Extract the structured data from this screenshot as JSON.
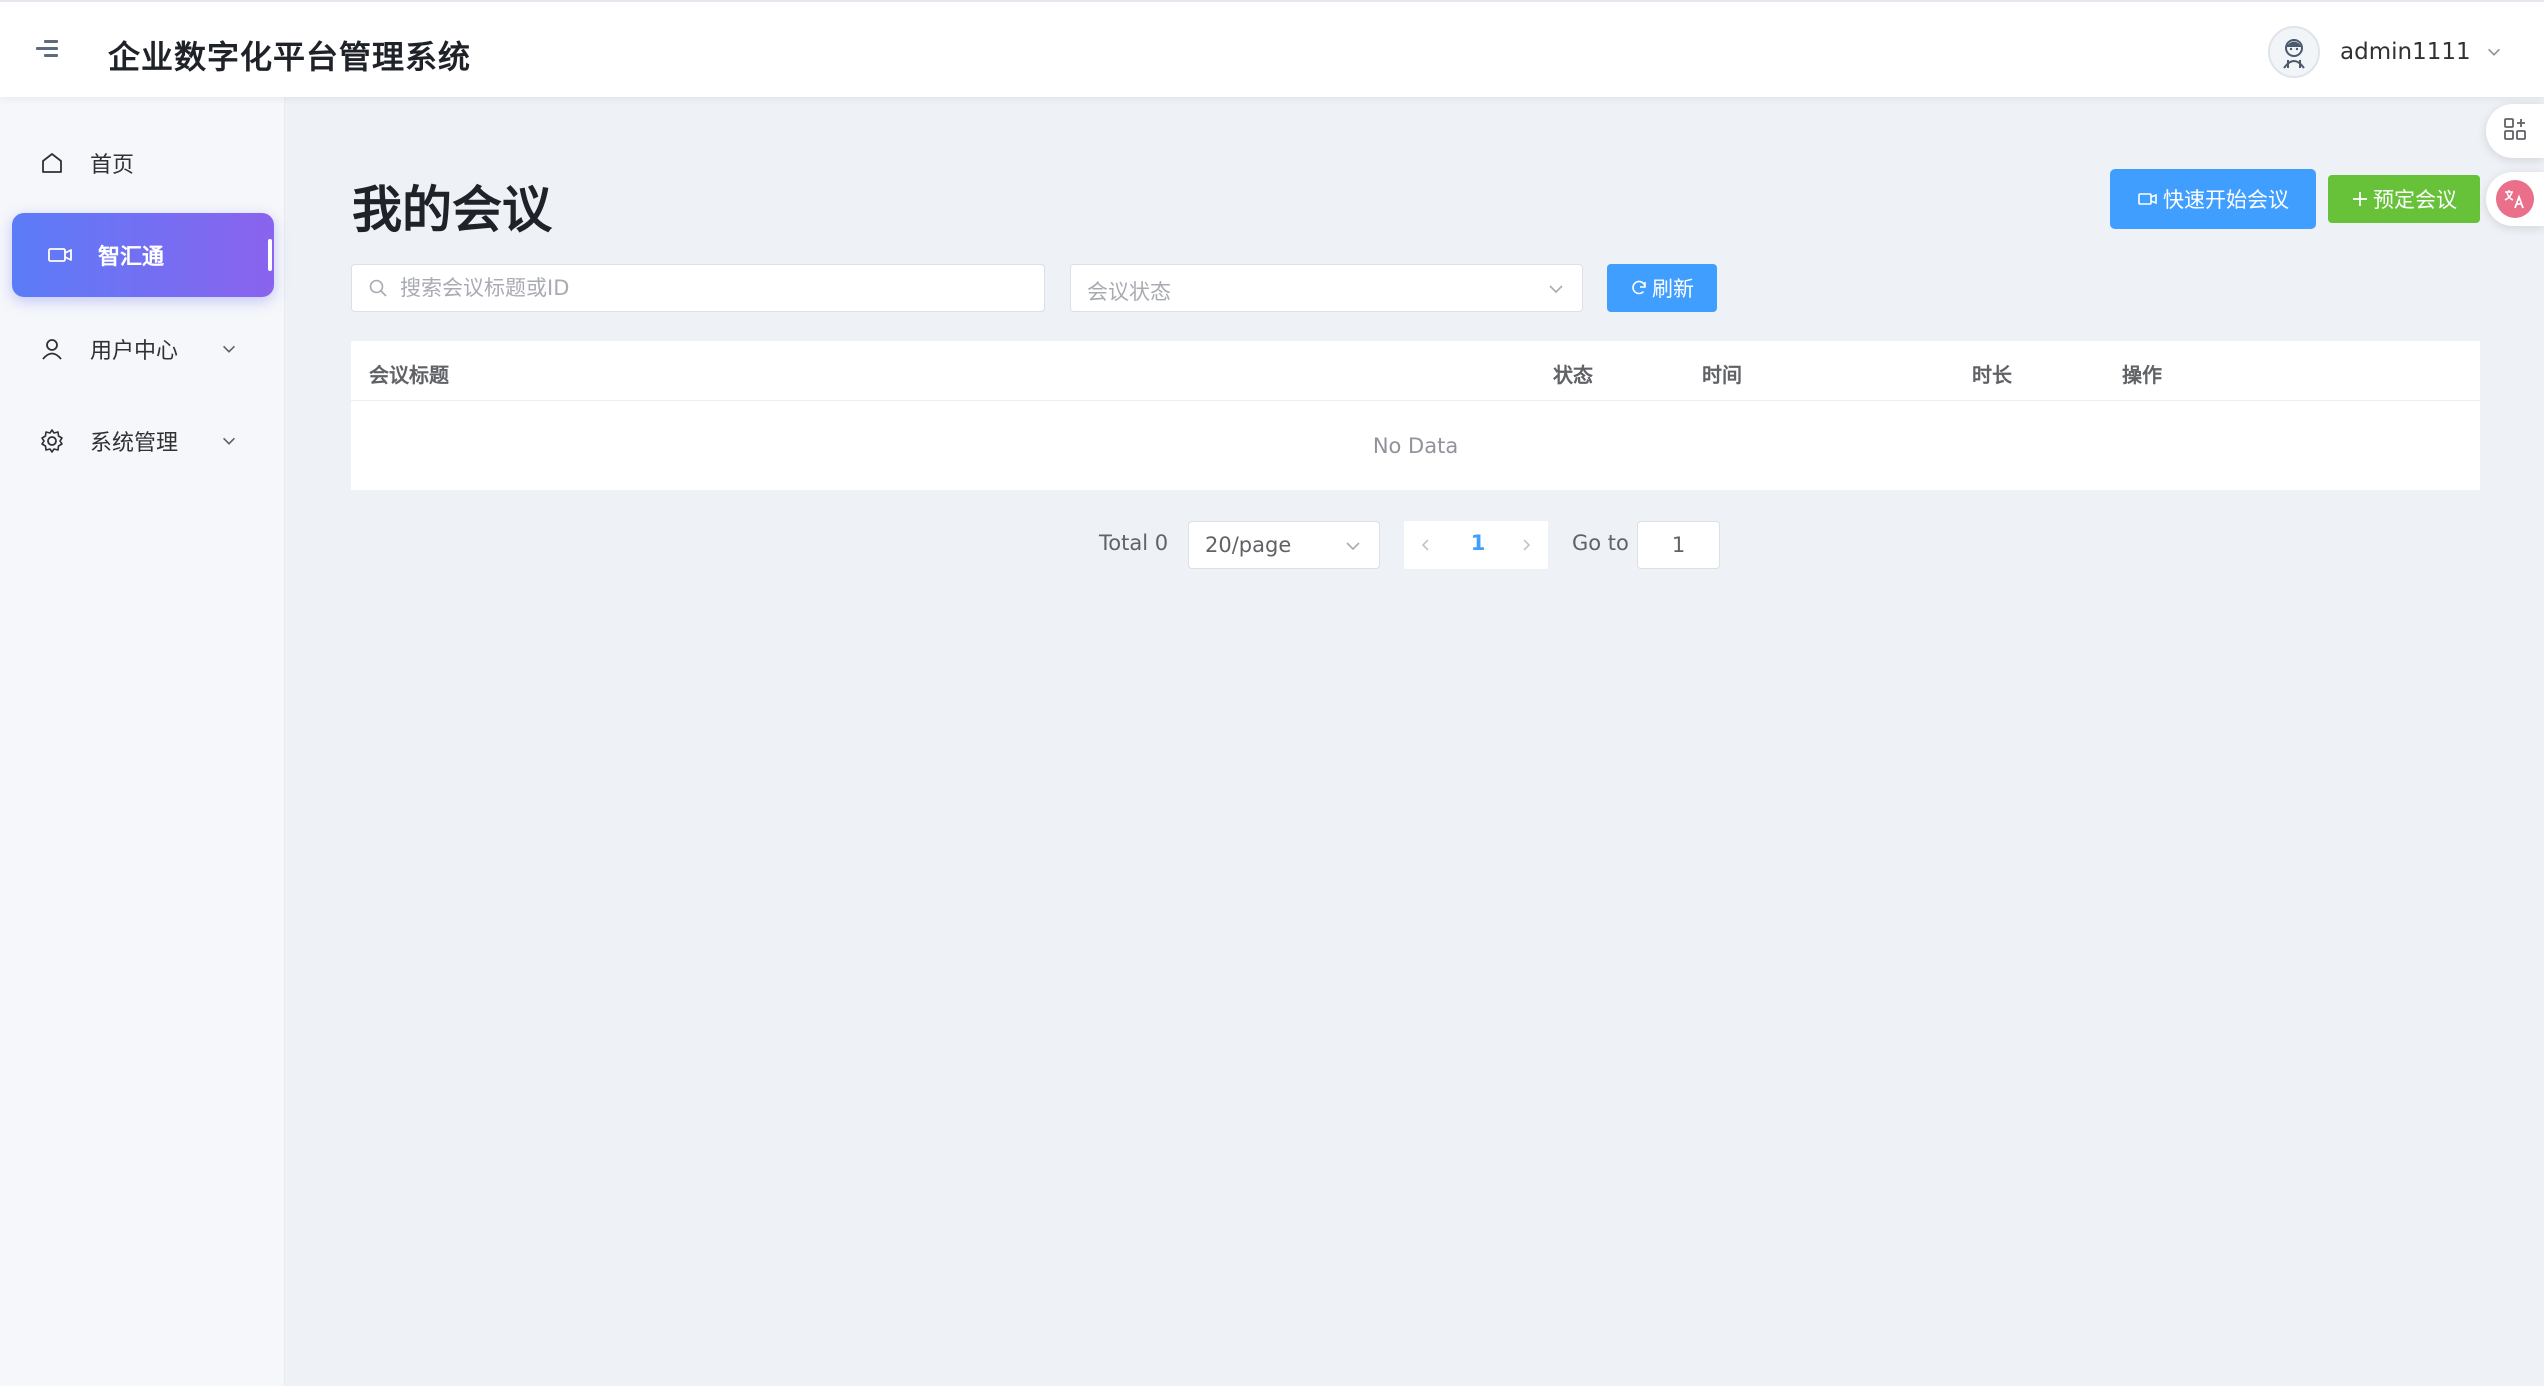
{
  "header": {
    "app_title": "企业数字化平台管理系统",
    "username": "admin1111"
  },
  "sidebar": {
    "items": [
      {
        "label": "首页",
        "icon": "home-icon",
        "active": false,
        "expandable": false
      },
      {
        "label": "智汇通",
        "icon": "video-camera-icon",
        "active": true,
        "expandable": false
      },
      {
        "label": "用户中心",
        "icon": "user-icon",
        "active": false,
        "expandable": true
      },
      {
        "label": "系统管理",
        "icon": "gear-icon",
        "active": false,
        "expandable": true
      }
    ]
  },
  "main": {
    "page_title": "我的会议",
    "quick_start_label": "快速开始会议",
    "book_meeting_label": "预定会议",
    "search": {
      "placeholder": "搜索会议标题或ID",
      "value": ""
    },
    "status_filter": {
      "placeholder": "会议状态"
    },
    "refresh_label": "刷新",
    "table": {
      "columns": [
        "会议标题",
        "状态",
        "时间",
        "时长",
        "操作"
      ],
      "rows": [],
      "empty_text": "No Data"
    },
    "pagination": {
      "total_text": "Total 0",
      "page_size": "20/page",
      "current_page": "1",
      "goto_label": "Go to",
      "goto_value": "1"
    }
  },
  "colors": {
    "primary": "#409eff",
    "success": "#67c23a",
    "active_gradient_start": "#5b7cf7",
    "active_gradient_end": "#8a63ee",
    "translate_badge": "#e96f8a"
  },
  "floating": {
    "apps_icon": "apps-grid-icon",
    "translate_icon": "translate-icon"
  }
}
